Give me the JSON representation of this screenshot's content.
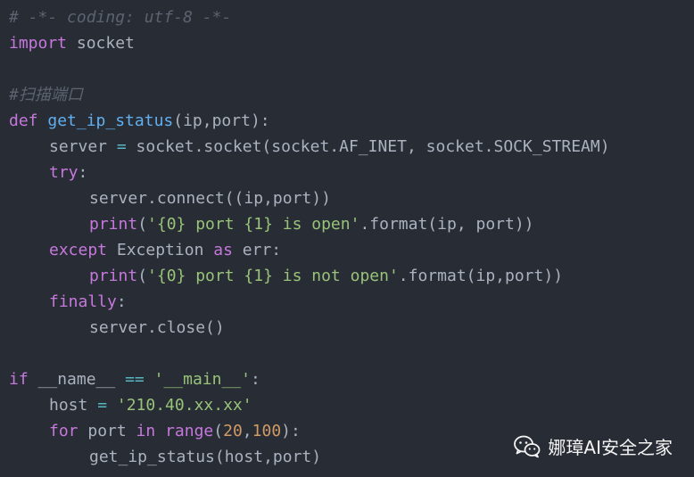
{
  "code": {
    "lines": [
      [
        {
          "t": "# -*- coding: utf-8 -*-",
          "c": "comment"
        }
      ],
      [
        {
          "t": "import",
          "c": "keyword"
        },
        {
          "t": " socket",
          "c": "plain"
        }
      ],
      [],
      [
        {
          "t": "#扫描端口",
          "c": "comment"
        }
      ],
      [
        {
          "t": "def",
          "c": "keyword"
        },
        {
          "t": " ",
          "c": "plain"
        },
        {
          "t": "get_ip_status",
          "c": "func"
        },
        {
          "t": "(ip,port):",
          "c": "punc"
        }
      ],
      [
        {
          "t": "server",
          "c": "plain"
        },
        {
          "t": " = ",
          "c": "op"
        },
        {
          "t": "socket.socket(socket.AF_INET, socket.SOCK_STREAM)",
          "c": "plain"
        }
      ],
      [
        {
          "t": "try",
          "c": "keyword"
        },
        {
          "t": ":",
          "c": "punc"
        }
      ],
      [
        {
          "t": "server.connect((ip,port))",
          "c": "plain"
        }
      ],
      [
        {
          "t": "print",
          "c": "builtin"
        },
        {
          "t": "(",
          "c": "punc"
        },
        {
          "t": "'{0} port {1} is open'",
          "c": "string"
        },
        {
          "t": ".format(ip, port))",
          "c": "plain"
        }
      ],
      [
        {
          "t": "except",
          "c": "keyword"
        },
        {
          "t": " Exception ",
          "c": "class"
        },
        {
          "t": "as",
          "c": "keyword"
        },
        {
          "t": " err:",
          "c": "plain"
        }
      ],
      [
        {
          "t": "print",
          "c": "builtin"
        },
        {
          "t": "(",
          "c": "punc"
        },
        {
          "t": "'{0} port {1} is not open'",
          "c": "string"
        },
        {
          "t": ".format(ip,port))",
          "c": "plain"
        }
      ],
      [
        {
          "t": "finally",
          "c": "keyword"
        },
        {
          "t": ":",
          "c": "punc"
        }
      ],
      [
        {
          "t": "server.close()",
          "c": "plain"
        }
      ],
      [],
      [
        {
          "t": "if",
          "c": "keyword"
        },
        {
          "t": " __name__ ",
          "c": "plain"
        },
        {
          "t": "==",
          "c": "op"
        },
        {
          "t": " ",
          "c": "plain"
        },
        {
          "t": "'__main__'",
          "c": "string"
        },
        {
          "t": ":",
          "c": "punc"
        }
      ],
      [
        {
          "t": "host",
          "c": "plain"
        },
        {
          "t": " = ",
          "c": "op"
        },
        {
          "t": "'210.40.xx.xx'",
          "c": "string"
        }
      ],
      [
        {
          "t": "for",
          "c": "keyword"
        },
        {
          "t": " port ",
          "c": "plain"
        },
        {
          "t": "in",
          "c": "keyword"
        },
        {
          "t": " ",
          "c": "plain"
        },
        {
          "t": "range",
          "c": "builtin"
        },
        {
          "t": "(",
          "c": "punc"
        },
        {
          "t": "20",
          "c": "number"
        },
        {
          "t": ",",
          "c": "punc"
        },
        {
          "t": "100",
          "c": "number"
        },
        {
          "t": "):",
          "c": "punc"
        }
      ],
      [
        {
          "t": "get_ip_status(host,port)",
          "c": "plain"
        }
      ]
    ],
    "indents": [
      0,
      0,
      0,
      0,
      0,
      1,
      1,
      2,
      2,
      1,
      2,
      1,
      2,
      0,
      0,
      1,
      1,
      2
    ]
  },
  "watermark": {
    "icon": "wechat-icon",
    "label": "娜璋AI安全之家"
  },
  "colors": {
    "background": "#282c34",
    "keyword": "#c678dd",
    "function": "#61afef",
    "string": "#98c379",
    "number": "#d19a66",
    "comment": "#5c6370",
    "operator": "#56b6c2",
    "text": "#abb2bf"
  }
}
